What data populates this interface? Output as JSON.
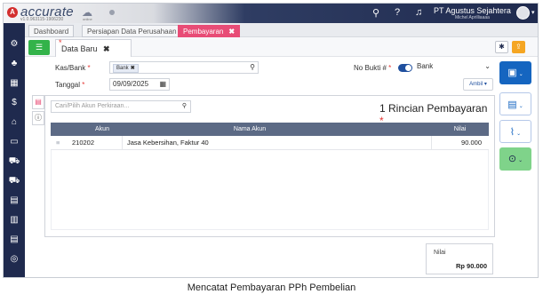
{
  "brand": {
    "name": "accurate",
    "version": "v1.0.963115-1906230",
    "online": "online",
    "company": "PT Agustus Sejahtera",
    "user": "Michel Aprilliaaaa"
  },
  "tabs": [
    {
      "label": "Dashboard"
    },
    {
      "label": "Persiapan Data Perusahaan"
    },
    {
      "label": "Pembayaran",
      "close": "✖"
    }
  ],
  "tab_count": "3 ▾",
  "subtab": {
    "label": "Data Baru",
    "close": "✖",
    "star": "*"
  },
  "form": {
    "kas_bank_label": "Kas/Bank",
    "kas_bank_value": "Bank",
    "kas_bank_chip_x": "✖",
    "tanggal_label": "Tanggal",
    "tanggal_value": "09/09/2025",
    "no_bukti_label": "No Bukti #",
    "no_bukti_value": "Bank",
    "ambil_label": "Ambil ▾",
    "required_mark": "*"
  },
  "detail": {
    "search_placeholder": "Cari/Pilih Akun Perkiraan...",
    "title": "1 Rincian Pembayaran",
    "columns": [
      "Akun",
      "Nama Akun",
      "Nilai"
    ],
    "rows": [
      {
        "akun": "210202",
        "nama_akun": "Jasa Kebersihan, Faktur 40",
        "nilai": "90.000"
      }
    ]
  },
  "total": {
    "label": "Nilai",
    "value": "Rp 90.000"
  },
  "caption": "Mencatat Pembayaran PPh Pembelian",
  "colors": {
    "sidebar": "#1f2a4e",
    "active_tab": "#e84c76",
    "save_button": "#1565c0",
    "list_button": "#33b34a",
    "table_header": "#5c6a85"
  },
  "icons": {
    "top": [
      "search-icon",
      "help-icon",
      "bell-icon"
    ],
    "sidebar": [
      "settings-icon",
      "org-icon",
      "building-icon",
      "cash-icon",
      "bank-icon",
      "card-icon",
      "cart-icon",
      "truck-icon",
      "inventory-icon",
      "factory-icon",
      "report-icon",
      "dashboard-icon"
    ]
  }
}
